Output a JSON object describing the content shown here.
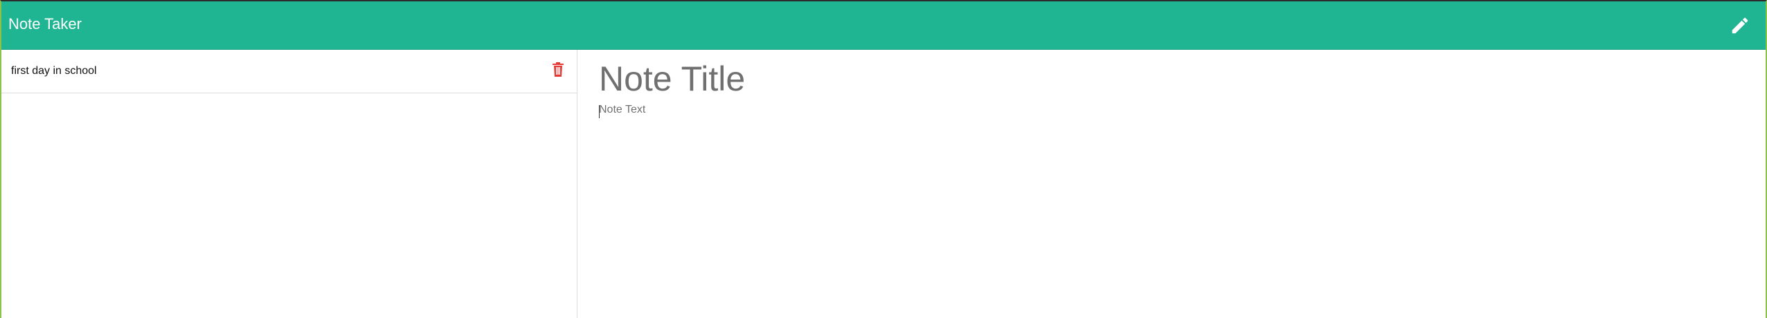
{
  "app": {
    "title": "Note Taker"
  },
  "header": {
    "new_note_icon": "pencil-icon"
  },
  "sidebar": {
    "notes": [
      {
        "title": "first day in school",
        "delete_icon": "trash-icon"
      }
    ]
  },
  "editor": {
    "title_placeholder": "Note Title",
    "text_placeholder": "Note Text"
  },
  "colors": {
    "navbar": "#20b592",
    "delete": "#e53935",
    "placeholder": "#707070"
  }
}
